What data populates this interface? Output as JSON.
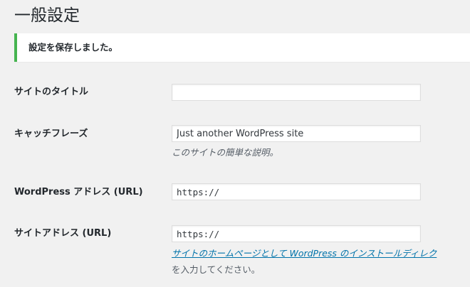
{
  "page": {
    "title": "一般設定"
  },
  "notice": {
    "message": "設定を保存しました。",
    "accent_color": "#46b450"
  },
  "fields": {
    "site_title": {
      "label": "サイトのタイトル",
      "value": ""
    },
    "tagline": {
      "label": "キャッチフレーズ",
      "value": "Just another WordPress site",
      "description": "このサイトの簡単な説明。"
    },
    "wp_address": {
      "label": "WordPress アドレス (URL)",
      "value": "https://"
    },
    "site_address": {
      "label": "サイトアドレス (URL)",
      "value": "https://",
      "help_link": "サイトのホームページとして WordPress のインストールディレク",
      "help_suffix": "を入力してください。"
    }
  },
  "colors": {
    "background": "#f1f1f1",
    "link": "#0073aa"
  }
}
